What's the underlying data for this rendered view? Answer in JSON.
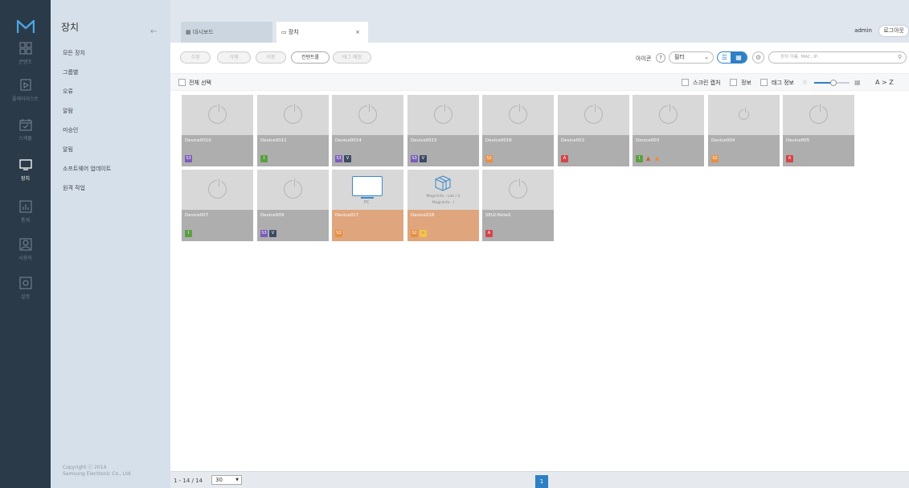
{
  "leftbar": {
    "items": [
      {
        "label": "콘텐츠",
        "icon": "content-icon"
      },
      {
        "label": "플레이리스트",
        "icon": "playlist-icon"
      },
      {
        "label": "스케쥴",
        "icon": "schedule-icon"
      },
      {
        "label": "장치",
        "icon": "device-icon"
      },
      {
        "label": "통계",
        "icon": "statistics-icon"
      },
      {
        "label": "사용자",
        "icon": "user-icon"
      },
      {
        "label": "설정",
        "icon": "settings-icon"
      }
    ],
    "active": "장치"
  },
  "submenu": {
    "title": "장치",
    "items": [
      "모든 장치",
      "그룹별",
      "오류",
      "알람",
      "미승인",
      "알림",
      "소프트웨어 업데이트",
      "원격 작업"
    ],
    "copyright_line1": "Copyright ⓒ 2014",
    "copyright_line2": "Samsung Electronic Co., Ltd."
  },
  "tabs": [
    {
      "label": "대시보드",
      "icon": "dashboard-icon"
    },
    {
      "label": "장치",
      "icon": "device-icon",
      "close": "×"
    }
  ],
  "header": {
    "user": "admin",
    "logout": "로그아웃"
  },
  "toolbar": {
    "buttons": [
      {
        "label": "수정",
        "enabled": false
      },
      {
        "label": "삭제",
        "enabled": false
      },
      {
        "label": "이동",
        "enabled": false
      },
      {
        "label": "컨텐트롤",
        "enabled": true
      },
      {
        "label": "태그 배정",
        "enabled": false
      }
    ],
    "icon_label": "아이콘",
    "help": "?",
    "filter_label": "필터",
    "search_placeholder": "장치 이름, MAC, IP,"
  },
  "selectbar": {
    "select_all": "전체 선택",
    "screen_capture": "스크린 캡처",
    "info": "정보",
    "tag_info": "태그 정보",
    "sort": "A > Z",
    "zoom_level": 0.55
  },
  "devices": [
    {
      "name": "Device0010",
      "badges": [
        "S3"
      ],
      "warn": false,
      "kind": "power"
    },
    {
      "name": "Device0011",
      "badges": [
        "I"
      ],
      "warn": false,
      "kind": "power"
    },
    {
      "name": "Device0014",
      "badges": [
        "S3",
        "V"
      ],
      "warn": false,
      "kind": "power"
    },
    {
      "name": "Device0015",
      "badges": [
        "S3",
        "V"
      ],
      "warn": false,
      "kind": "power"
    },
    {
      "name": "Device0016",
      "badges": [
        "S2"
      ],
      "warn": false,
      "kind": "power"
    },
    {
      "name": "Device002",
      "badges": [
        "A"
      ],
      "warn": false,
      "kind": "power"
    },
    {
      "name": "Device003",
      "badges": [
        "I",
        "warn",
        "tri"
      ],
      "warn": false,
      "kind": "power"
    },
    {
      "name": "Device004",
      "badges": [
        "S2"
      ],
      "warn": false,
      "kind": "power-small"
    },
    {
      "name": "Device005",
      "badges": [
        "A"
      ],
      "warn": false,
      "kind": "power"
    },
    {
      "name": "Device007",
      "badges": [
        "I"
      ],
      "warn": false,
      "kind": "power"
    },
    {
      "name": "Device009",
      "badges": [
        "S3",
        "V"
      ],
      "warn": false,
      "kind": "power"
    },
    {
      "name": "Device017",
      "badges": [
        "S2"
      ],
      "warn": true,
      "kind": "pc",
      "sub_label": "PC"
    },
    {
      "name": "Device018",
      "badges": [
        "S2",
        "W"
      ],
      "warn": true,
      "kind": "magicinfo",
      "sub_label": "MagicInfo - Lite / S",
      "sub_label2": "MagicInfo - I"
    },
    {
      "name": "SELV-NoteS",
      "badges": [
        "A"
      ],
      "warn": false,
      "kind": "power"
    }
  ],
  "footer": {
    "count": "1 - 14 / 14",
    "page_size": "30",
    "page": "1"
  }
}
